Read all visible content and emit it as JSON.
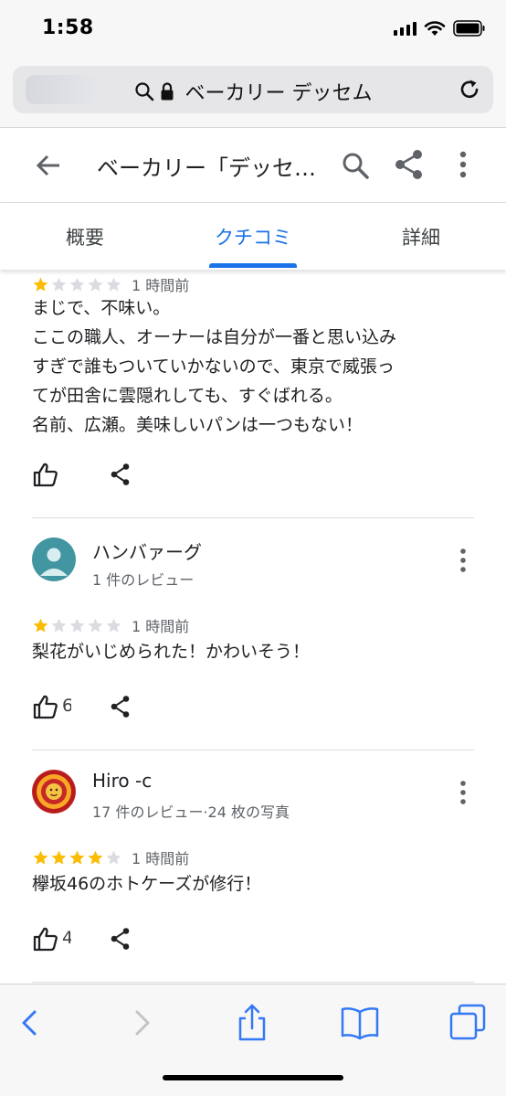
{
  "status_bar": {
    "time": "1:58",
    "icons": [
      "cellular-signal-icon",
      "wifi-icon",
      "battery-icon"
    ]
  },
  "browser": {
    "url_text": "ベーカリー デッセム",
    "icons": [
      "search-icon",
      "lock-icon",
      "reload-icon"
    ]
  },
  "header": {
    "title": "ベーカリー「デッセ…",
    "icons": [
      "back-arrow-icon",
      "search-icon",
      "share-icon",
      "more-vert-icon"
    ]
  },
  "tabs": [
    {
      "label": "概要",
      "active": false
    },
    {
      "label": "クチコミ",
      "active": true
    },
    {
      "label": "詳細",
      "active": false
    }
  ],
  "reviews": [
    {
      "rating": 1,
      "time_ago": "1 時間前",
      "lines": [
        "まじで、不味い。",
        "ここの職人、オーナーは自分が一番と思い込み",
        "すぎで誰もついていかないので、東京で威張っ",
        "てが田舎に雲隠れしても、すぐばれる。",
        "名前、広瀬。美味しいパンは一つもない！"
      ],
      "like_count": ""
    },
    {
      "reviewer": "ハンバァーグ",
      "meta": "1 件のレビュー",
      "rating": 1,
      "time_ago": "1 時間前",
      "lines": [
        "梨花がいじめられた！かわいそう！"
      ],
      "like_count": "6"
    },
    {
      "reviewer": "Hiro -c",
      "meta": "17 件のレビュー·24 枚の写真",
      "rating": 4,
      "time_ago": "1 時間前",
      "lines": [
        "欅坂46のホトケーズが修行！"
      ],
      "like_count": "4"
    }
  ],
  "colors": {
    "accent": "#1a73e8",
    "star_filled": "#fbbc04",
    "star_empty": "#dadce0",
    "avatar_bg": "#4296a1",
    "ios_blue": "#3478f6"
  },
  "toolbar": {
    "icons": [
      "back-icon",
      "forward-icon",
      "share-icon",
      "bookmarks-icon",
      "tabs-icon"
    ]
  }
}
